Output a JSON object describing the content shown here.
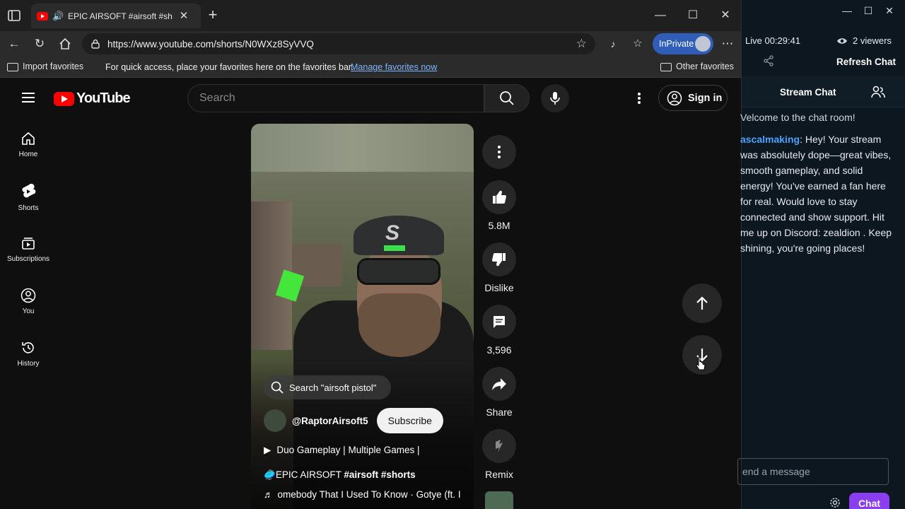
{
  "browser": {
    "tab_title": "EPIC AIRSOFT #airsoft #sh",
    "url": "https://www.youtube.com/shorts/N0WXz8SyVVQ",
    "inprivate_label": "InPrivate",
    "favbar": {
      "import_label": "Import favorites",
      "message": "For quick access, place your favorites here on the favorites bar.",
      "manage_link": "Manage favorites now",
      "other_label": "Other favorites"
    }
  },
  "youtube": {
    "logo_text": "YouTube",
    "search_placeholder": "Search",
    "signin_label": "Sign in",
    "sidebar": [
      {
        "label": "Home",
        "icon": "home-icon"
      },
      {
        "label": "Shorts",
        "icon": "shorts-icon"
      },
      {
        "label": "Subscriptions",
        "icon": "subscriptions-icon"
      },
      {
        "label": "You",
        "icon": "you-icon"
      },
      {
        "label": "History",
        "icon": "history-icon"
      }
    ],
    "short": {
      "search_chip": "Search \"airsoft pistol\"",
      "channel": "@RaptorAirsoft5",
      "subscribe_label": "Subscribe",
      "playlist": "Duo Gameplay | Multiple Games |",
      "title_plain": "EPIC AIRSOFT ",
      "title_tags": "#airsoft #shorts",
      "music": "omebody That I Used To Know · Gotye (ft. I"
    },
    "actions": {
      "likes": "5.8M",
      "dislike": "Dislike",
      "comments": "3,596",
      "share": "Share",
      "remix": "Remix"
    }
  },
  "chat": {
    "live": "Live 00:29:41",
    "viewers": "2 viewers",
    "refresh": "Refresh Chat",
    "header": "Stream Chat",
    "welcome": "Velcome to the chat room!",
    "message_user": "ascalmaking",
    "message_text": ": Hey! Your stream was absolutely dope—great vibes, smooth gameplay, and solid energy! You've earned a fan here for real. Would love to stay connected and show support. Hit me up on Discord: zealdion . Keep shining, you're going places!",
    "input_placeholder": "end a message",
    "send_label": "Chat",
    "accent_color": "#8b3df0"
  }
}
